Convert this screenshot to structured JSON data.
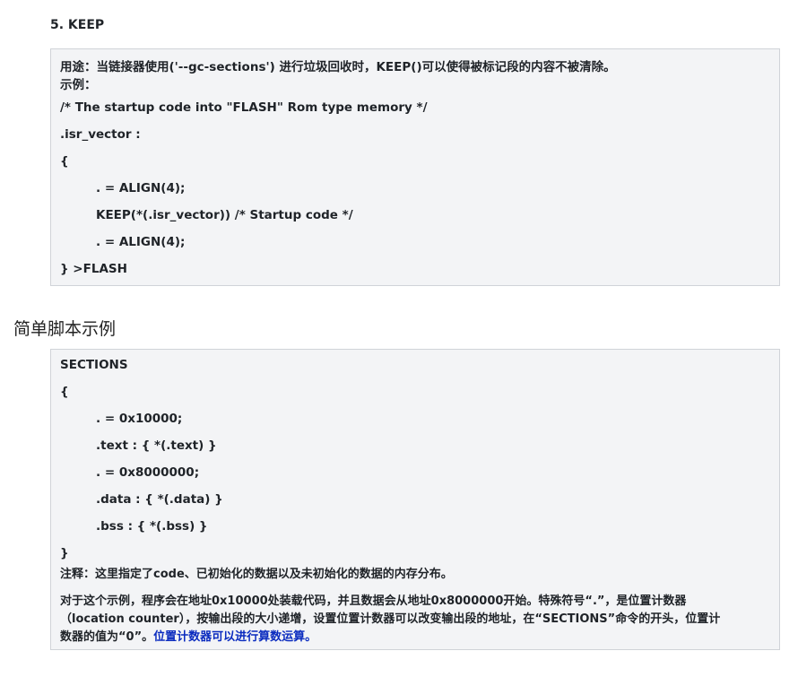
{
  "heading": "5. KEEP",
  "keep_box": {
    "usage": "用途：当链接器使用('--gc-sections') 进行垃圾回收时，KEEP()可以使得被标记段的内容不被清除。",
    "example_label": "示例：",
    "code": [
      "/* The startup code into \"FLASH\" Rom type memory */",
      ".isr_vector :",
      "{",
      ". = ALIGN(4);",
      "KEEP(*(.isr_vector)) /* Startup code */",
      ". = ALIGN(4);",
      "} >FLASH"
    ]
  },
  "section_title": "简单脚本示例",
  "script_box": {
    "code": [
      "SECTIONS",
      "{",
      ". = 0x10000;",
      ".text : { *(.text) }",
      ". = 0x8000000;",
      ".data : { *(.data) }",
      ".bss : { *(.bss) }",
      "}"
    ],
    "note": "注释：这里指定了code、已初始化的数据以及未初始化的数据的内存分布。",
    "para_line1": "对于这个示例，程序会在地址0x10000处装载代码，并且数据会从地址0x8000000开始。特殊符号“.”，是位置计数器",
    "para_line2": "（location counter），按输出段的大小递增，设置位置计数器可以改变输出段的地址，在“SECTIONS”命令的开头，位置计",
    "para_line3_a": "数器的值为“0”。",
    "para_line3_b": "位置计数器可以进行算数运算。"
  }
}
